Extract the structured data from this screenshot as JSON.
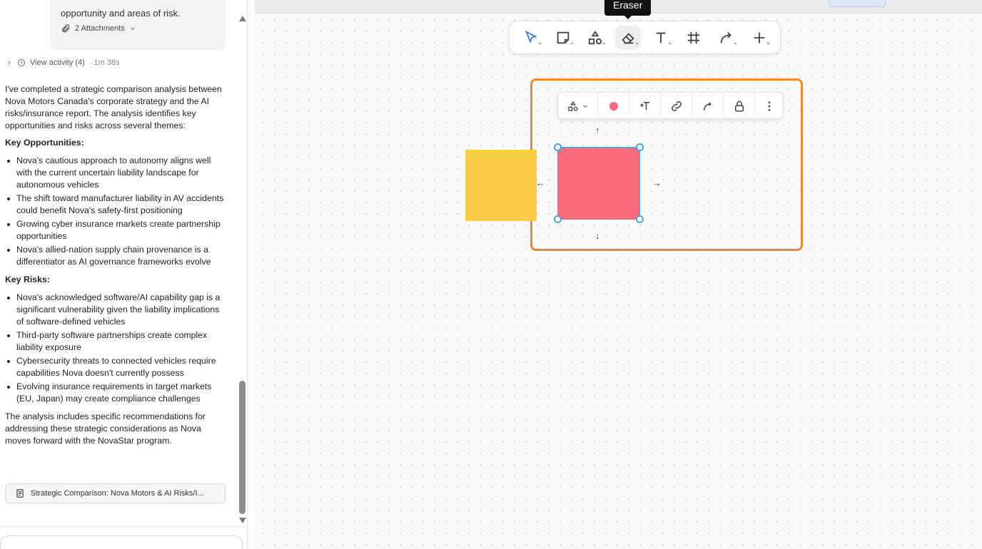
{
  "chat": {
    "card_text": "opportunity and areas of risk.",
    "attachments_label": "2 Attachments",
    "activity_label": "View activity (4)",
    "activity_time": "· 1m 38s",
    "intro": "I've completed a strategic comparison analysis between Nova Motors Canada's corporate strategy and the AI risks/insurance report. The analysis identifies key opportunities and risks across several themes:",
    "opportunities_heading": "Key Opportunities:",
    "opportunities": [
      "Nova's cautious approach to autonomy aligns well with the current uncertain liability landscape for autonomous vehicles",
      "The shift toward manufacturer liability in AV accidents could benefit Nova's safety-first positioning",
      "Growing cyber insurance markets create partnership opportunities",
      "Nova's allied-nation supply chain provenance is a differentiator as AI governance frameworks evolve"
    ],
    "risks_heading": "Key Risks:",
    "risks": [
      "Nova's acknowledged software/AI capability gap is a significant vulnerability given the liability implications of software-defined vehicles",
      "Third-party software partnerships create complex liability exposure",
      "Cybersecurity threats to connected vehicles require capabilities Nova doesn't currently possess",
      "Evolving insurance requirements in target markets (EU, Japan) may create compliance challenges"
    ],
    "conclusion": "The analysis includes specific recommendations for addressing these strategic considerations as Nova moves forward with the NovaStar program.",
    "artifact_label": "Strategic Comparison: Nova Motors & AI Risks/I..."
  },
  "canvas": {
    "tooltip": "Eraser",
    "tools": [
      {
        "name": "select-tool",
        "icon": "cursor-icon"
      },
      {
        "name": "note-tool",
        "icon": "note-icon"
      },
      {
        "name": "shapes-tool",
        "icon": "shapes-icon"
      },
      {
        "name": "eraser-tool",
        "icon": "eraser-icon",
        "active": true
      },
      {
        "name": "text-tool",
        "icon": "text-icon"
      },
      {
        "name": "frame-tool",
        "icon": "frame-icon"
      },
      {
        "name": "connector-tool",
        "icon": "connector-icon"
      },
      {
        "name": "add-tool",
        "icon": "plus-icon"
      }
    ],
    "colors": {
      "frame": "#ed8a2e",
      "yellow_shape": "#f9cd45",
      "pink_shape": "#f76b7d",
      "selection": "#4aa3e0",
      "toolbar_accent": "#3b7ddd"
    }
  }
}
